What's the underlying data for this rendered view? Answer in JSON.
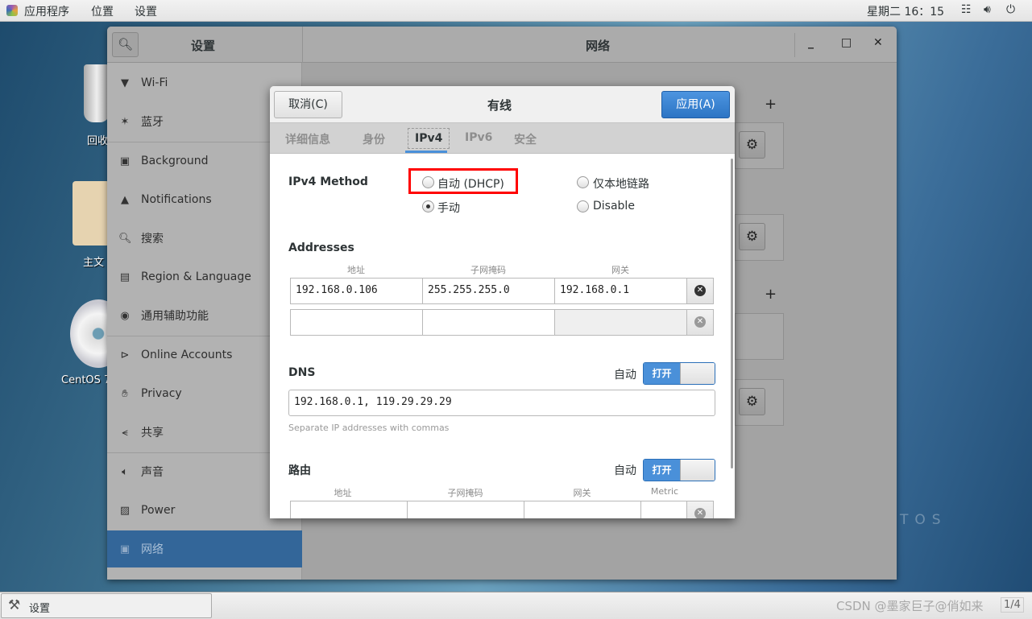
{
  "topbar": {
    "apps": "应用程序",
    "places": "位置",
    "settings": "设置",
    "clock": "星期二 16：15",
    "icons": [
      "network-icon",
      "volume-icon",
      "power-icon"
    ]
  },
  "desktop": {
    "icons": [
      {
        "label": "回收站",
        "shown": "回收"
      },
      {
        "label": "主文件夹",
        "shown": "主文"
      },
      {
        "label": "CentOS 7",
        "shown": "CentOS 7"
      }
    ],
    "watermark": "7",
    "brand": "TOS"
  },
  "settings_window": {
    "sidebar_title": "设置",
    "panel_title": "网络",
    "sidebar": [
      {
        "label": "Wi-Fi",
        "icon": "wifi-icon"
      },
      {
        "label": "蓝牙",
        "icon": "bluetooth-icon"
      },
      {
        "label": "Background",
        "icon": "background-icon"
      },
      {
        "label": "Notifications",
        "icon": "bell-icon"
      },
      {
        "label": "搜索",
        "icon": "search-icon"
      },
      {
        "label": "Region & Language",
        "icon": "region-icon"
      },
      {
        "label": "通用辅助功能",
        "icon": "accessibility-icon"
      },
      {
        "label": "Online Accounts",
        "icon": "online-accounts-icon"
      },
      {
        "label": "Privacy",
        "icon": "hand-icon"
      },
      {
        "label": "共享",
        "icon": "share-icon"
      },
      {
        "label": "声音",
        "icon": "sound-icon"
      },
      {
        "label": "Power",
        "icon": "power-icon"
      },
      {
        "label": "网络",
        "icon": "network-icon",
        "active": true
      }
    ]
  },
  "dialog": {
    "title": "有线",
    "cancel": "取消(C)",
    "apply": "应用(A)",
    "tabs": [
      "详细信息",
      "身份",
      "IPv4",
      "IPv6",
      "安全"
    ],
    "active_tab": "IPv4",
    "method_label": "IPv4 Method",
    "methods": [
      {
        "label": "自动 (DHCP)",
        "selected": false
      },
      {
        "label": "仅本地链路",
        "selected": false
      },
      {
        "label": "手动",
        "selected": true
      },
      {
        "label": "Disable",
        "selected": false
      }
    ],
    "addresses": {
      "title": "Addresses",
      "headers": [
        "地址",
        "子网掩码",
        "网关"
      ],
      "rows": [
        [
          "192.168.0.106",
          "255.255.255.0",
          "192.168.0.1"
        ],
        [
          "",
          "",
          ""
        ]
      ]
    },
    "dns": {
      "title": "DNS",
      "auto_label": "自动",
      "toggle": "打开",
      "value": "192.168.0.1, 119.29.29.29",
      "hint": "Separate IP addresses with commas"
    },
    "routes": {
      "title": "路由",
      "auto_label": "自动",
      "toggle": "打开",
      "headers": [
        "地址",
        "子网掩码",
        "网关",
        "Metric"
      ]
    },
    "highlight_color": "#ff0000"
  },
  "taskbar": {
    "window_label": "设置",
    "watermark": "CSDN @墨家巨子@俏如来",
    "workspace": "1/4"
  }
}
